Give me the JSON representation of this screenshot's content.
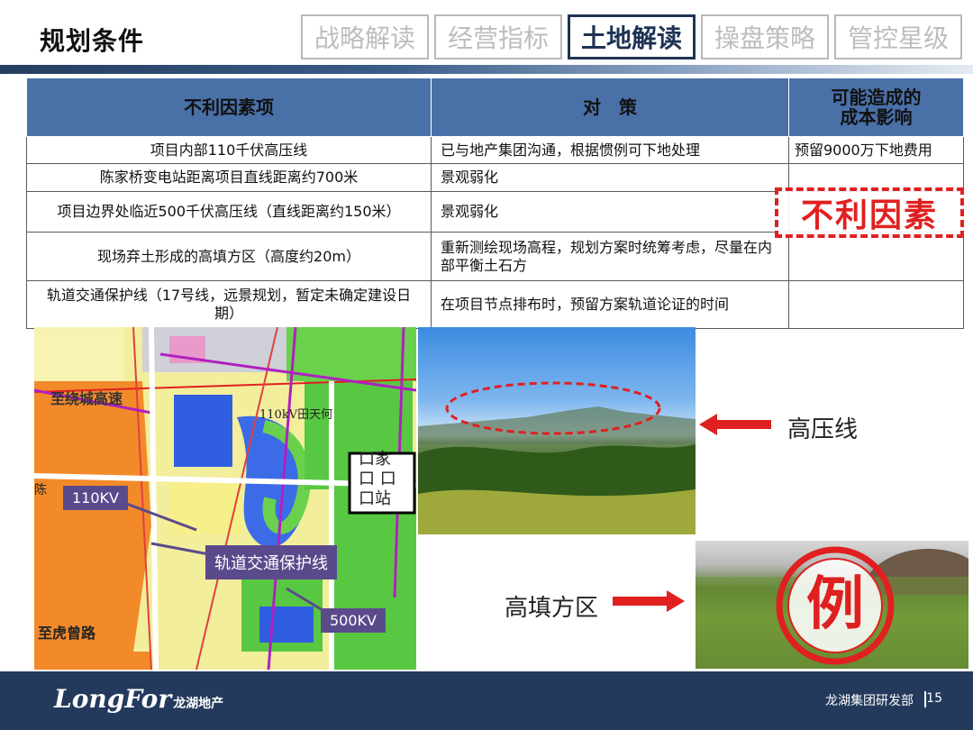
{
  "page_title": "规划条件",
  "tabs": [
    {
      "label": "战略解读",
      "active": false
    },
    {
      "label": "经营指标",
      "active": false
    },
    {
      "label": "土地解读",
      "active": true
    },
    {
      "label": "操盘策略",
      "active": false
    },
    {
      "label": "管控星级",
      "active": false
    }
  ],
  "table": {
    "headers": [
      "不利因素项",
      "对　策",
      "可能造成的\n成本影响"
    ],
    "rows": [
      [
        "项目内部110千伏高压线",
        "已与地产集团沟通，根据惯例可下地处理",
        "预留9000万下地费用"
      ],
      [
        "陈家桥变电站距离项目直线距离约700米",
        "景观弱化",
        ""
      ],
      [
        "项目边界处临近500千伏高压线（直线距离约150米）",
        "景观弱化",
        ""
      ],
      [
        "现场弃土形成的高填方区（高度约20m）",
        "重新测绘现场高程，规划方案时统筹考虑，尽量在内部平衡土石方",
        ""
      ],
      [
        "轨道交通保护线（17号线，远景规划，暂定未确定建设日期）",
        "在项目节点排布时，预留方案轨道论证的时间",
        ""
      ]
    ]
  },
  "stamp_text": "不利因素",
  "stamp_example": "例",
  "map": {
    "labels": {
      "kv110": "110KV",
      "rail": "轨道交通保护线",
      "kv500": "500KV",
      "road_top": "至绕城高速",
      "road_bottom": "至虎曾路",
      "line_label": "110kV田天何",
      "station": "口家\n口 口\n口站",
      "left_edge": "陈"
    }
  },
  "annotations": {
    "high_voltage": "高压线",
    "high_fill": "高填方区"
  },
  "footer": {
    "logo": "LongFor",
    "logo_cn": "龙湖地产",
    "department": "龙湖集团研发部",
    "page_number": "15"
  },
  "colors": {
    "header_blue": "#4a70a8",
    "footer_navy": "#233a5c",
    "accent_red": "#e02020",
    "label_purple": "#5b4a8b"
  }
}
